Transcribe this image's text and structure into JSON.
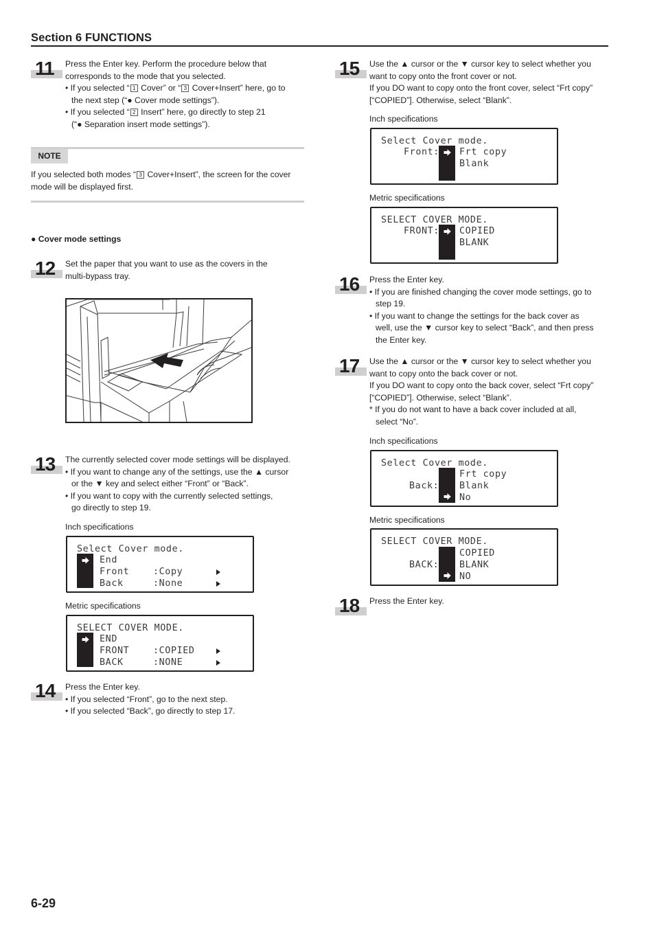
{
  "header": {
    "section_title": "Section 6  FUNCTIONS"
  },
  "footer": {
    "page_number": "6-29"
  },
  "steps": {
    "s11": {
      "number": "11",
      "lines": [
        "Press the Enter key. Perform the procedure below that",
        "corresponds to the mode that you selected."
      ],
      "bullet1a": "• If you selected “",
      "box1": "1",
      "bullet1b": " Cover” or “",
      "box3": "3",
      "bullet1c": " Cover+Insert” here, go to",
      "bullet1d": "the next step (“● Cover mode settings”).",
      "bullet2a": "• If you selected “",
      "box2": "2",
      "bullet2b": " Insert” here, go directly to step 21",
      "bullet2c": "(“● Separation insert mode settings”)."
    },
    "note": {
      "badge": "NOTE",
      "text_a": "If you selected both modes “",
      "box": "3",
      "text_b": " Cover+Insert”, the screen for the cover",
      "text_c": "mode will be displayed first."
    },
    "cover_heading": "● Cover mode settings",
    "s12": {
      "number": "12",
      "lines": [
        "Set the paper that you want to use as the covers in the",
        "multi-bypass tray."
      ]
    },
    "s13": {
      "number": "13",
      "line1": "The currently selected cover mode settings will be displayed.",
      "bullet1a": "• If you want to change any of the settings, use the ▲ cursor",
      "bullet1b": "or the ▼ key and select either “Front” or “Back”.",
      "bullet2a": "• If you want to copy with the currently selected settings,",
      "bullet2b": "go directly to step 19.",
      "inch_label": "Inch specifications",
      "metric_label": "Metric specifications",
      "inch_lcd": [
        "Select Cover mode.",
        "End",
        "Front    :Copy",
        "Back     :None"
      ],
      "metric_lcd": [
        "SELECT COVER MODE.",
        "END",
        "FRONT    :COPIED",
        "BACK     :NONE"
      ]
    },
    "s14": {
      "number": "14",
      "line1": "Press the Enter key.",
      "bullet1": "• If you selected “Front”, go to the next step.",
      "bullet2": "• If you selected “Back”, go directly to step 17."
    },
    "s15": {
      "number": "15",
      "lines": [
        "Use the ▲ cursor or the ▼ cursor key to select whether you",
        "want to copy onto the front cover or not.",
        "If you DO want to copy onto the front cover, select “Frt copy”",
        "[“COPIED”]. Otherwise, select “Blank”."
      ],
      "inch_label": "Inch specifications",
      "metric_label": "Metric specifications",
      "inch_lcd": {
        "title": "Select Cover mode.",
        "side": "Front:",
        "options": [
          "Frt copy",
          "Blank"
        ]
      },
      "metric_lcd": {
        "title": "SELECT COVER MODE.",
        "side": "FRONT:",
        "options": [
          "COPIED",
          "BLANK"
        ]
      }
    },
    "s16": {
      "number": "16",
      "line1": "Press the Enter key.",
      "bullet1a": "• If you are finished changing the cover mode settings, go to",
      "bullet1b": "step 19.",
      "bullet2a": "• If you want to change the settings for the back cover as",
      "bullet2b": "well, use the ▼ cursor key to select “Back”, and then press",
      "bullet2c": "the Enter key."
    },
    "s17": {
      "number": "17",
      "lines": [
        "Use the ▲ cursor or the ▼ cursor key to select whether you",
        "want to copy onto the back cover or not.",
        "If you DO want to copy onto the back cover, select “Frt copy”",
        "[“COPIED”]. Otherwise, select “Blank”."
      ],
      "note_a": "* If you do not want to have a back cover included at all,",
      "note_b": "select “No”.",
      "inch_label": "Inch specifications",
      "metric_label": "Metric specifications",
      "inch_lcd": {
        "title": "Select Cover mode.",
        "side": "Back:",
        "options": [
          "Frt copy",
          "Blank",
          "No"
        ]
      },
      "metric_lcd": {
        "title": "SELECT COVER MODE.",
        "side": "BACK:",
        "options": [
          "COPIED",
          "BLANK",
          "NO"
        ]
      }
    },
    "s18": {
      "number": "18",
      "line1": "Press the Enter key."
    }
  },
  "icons": {
    "cursor_arrow": "right-arrow-icon",
    "submenu": "triangle-right-icon"
  },
  "colors": {
    "text": "#231f20",
    "step_bar": "#cfcfcf",
    "lcd_cursor": "#231f20"
  }
}
